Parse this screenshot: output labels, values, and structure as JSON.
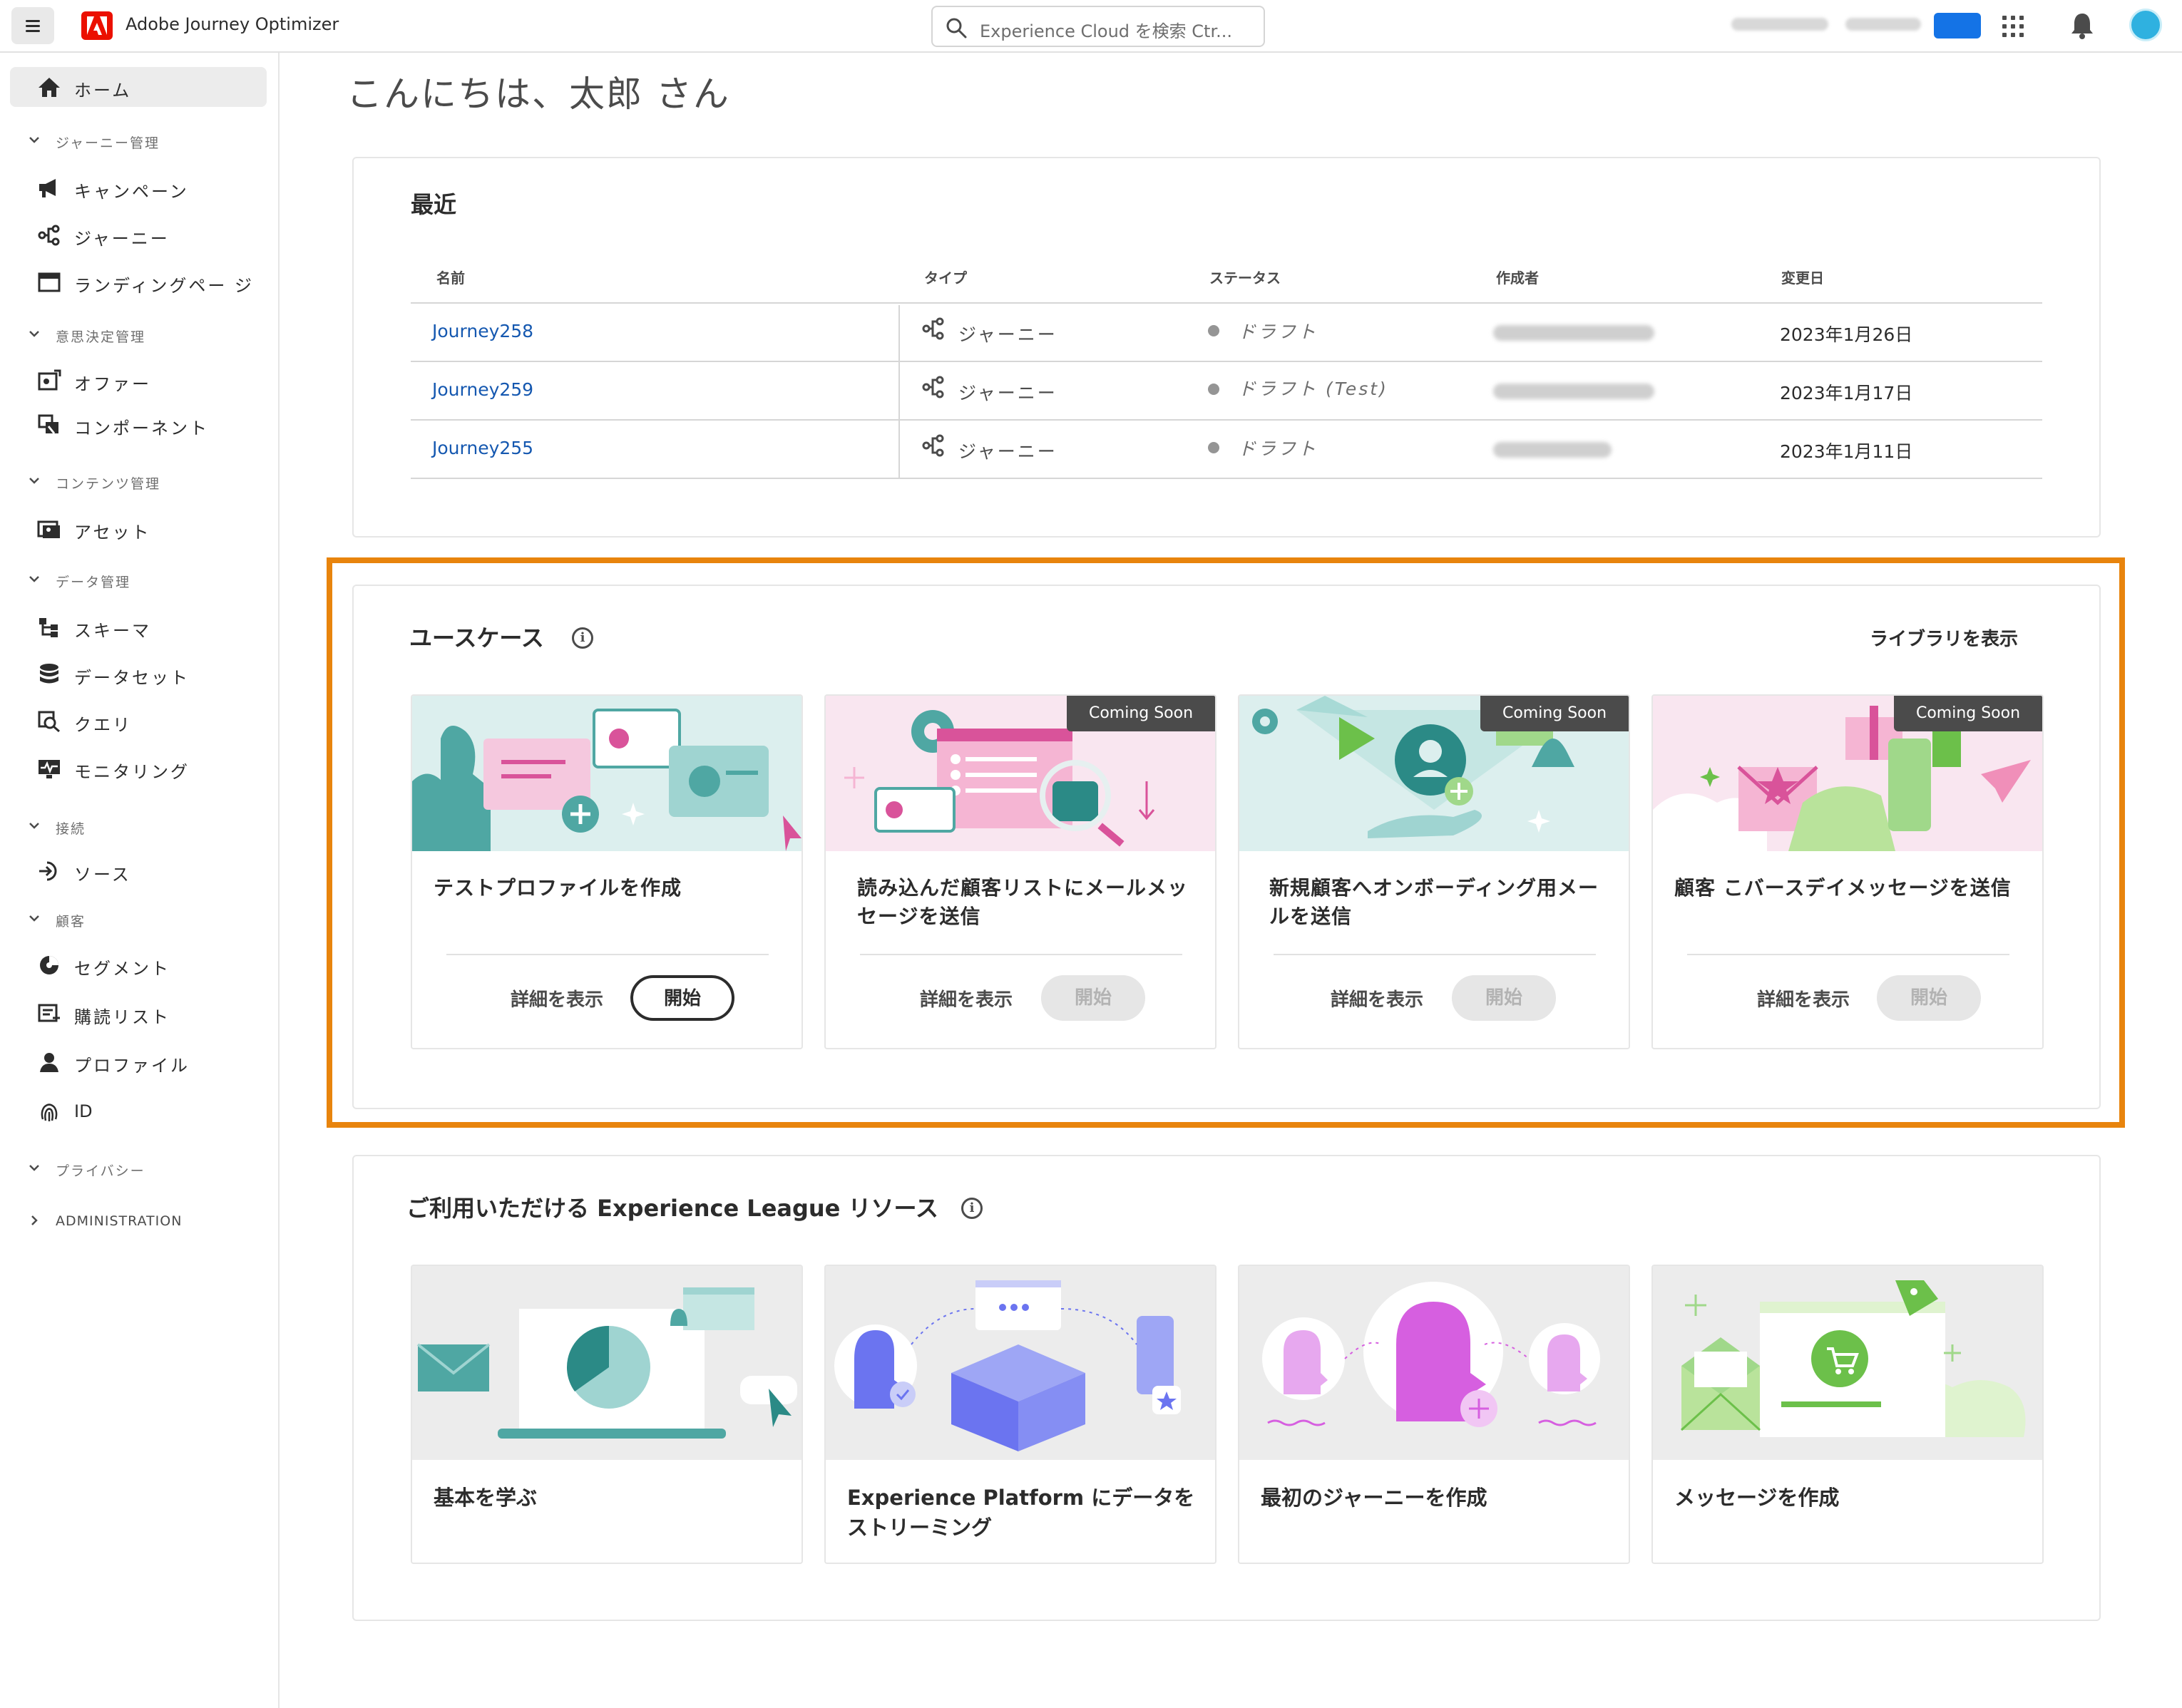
{
  "topbar": {
    "app_title": "Adobe Journey Optimizer",
    "search_placeholder": "Experience Cloud を検索 Ctr..."
  },
  "sidebar": {
    "home": "ホーム",
    "sections": {
      "journey_mgmt": "ジャーニー管理",
      "decision_mgmt": "意思決定管理",
      "content_mgmt": "コンテンツ管理",
      "data_mgmt": "データ管理",
      "connections": "接続",
      "customer": "顧客",
      "privacy": "プライバシー",
      "administration": "ADMINISTRATION"
    },
    "items": {
      "campaigns": "キャンペーン",
      "journeys": "ジャーニー",
      "landing_pages": "ランディングペー ジ",
      "offers": "オファー",
      "components": "コンポーネント",
      "assets": "アセット",
      "schemas": "スキーマ",
      "datasets": "データセット",
      "queries": "クエリ",
      "monitoring": "モニタリング",
      "sources": "ソース",
      "segments": "セグメント",
      "subscription_lists": "購読リスト",
      "profiles": "プロファイル",
      "identities": "ID"
    }
  },
  "main": {
    "greeting": "こんにちは、太郎 さん",
    "recent": {
      "title": "最近",
      "columns": [
        "名前",
        "タイプ",
        "ステータス",
        "作成者",
        "変更日"
      ],
      "rows": [
        {
          "name": "Journey258",
          "type": "ジャーニー",
          "status": "ドラフト",
          "modified": "2023年1月26日"
        },
        {
          "name": "Journey259",
          "type": "ジャーニー",
          "status": "ドラフト (Test)",
          "modified": "2023年1月17日"
        },
        {
          "name": "Journey255",
          "type": "ジャーニー",
          "status": "ドラフト",
          "modified": "2023年1月11日"
        }
      ]
    },
    "usecases": {
      "title": "ユースケース",
      "library_link": "ライブラリを表示",
      "details_label": "詳細を表示",
      "start_label": "開始",
      "coming_soon": "Coming Soon",
      "cards": [
        {
          "title": "テストプロファイルを作成"
        },
        {
          "title": "読み込んだ顧客リストにメールメッセージを送信"
        },
        {
          "title": "新規顧客へオンボーディング用メールを送信"
        },
        {
          "title": "顧客 こバースデイメッセージを送信"
        }
      ]
    },
    "resources": {
      "title": "ご利用いただける Experience League リソース",
      "cards": [
        {
          "title": "基本を学ぶ"
        },
        {
          "title": "Experience Platform にデータをストリーミング"
        },
        {
          "title": "最初のジャーニーを作成"
        },
        {
          "title": "メッセージを作成"
        }
      ]
    }
  },
  "colors": {
    "highlight": "#e8840d",
    "link": "#1558b0",
    "adobe_red": "#eb1000",
    "teal": "#4fa7a3",
    "pink": "#d9539a"
  }
}
